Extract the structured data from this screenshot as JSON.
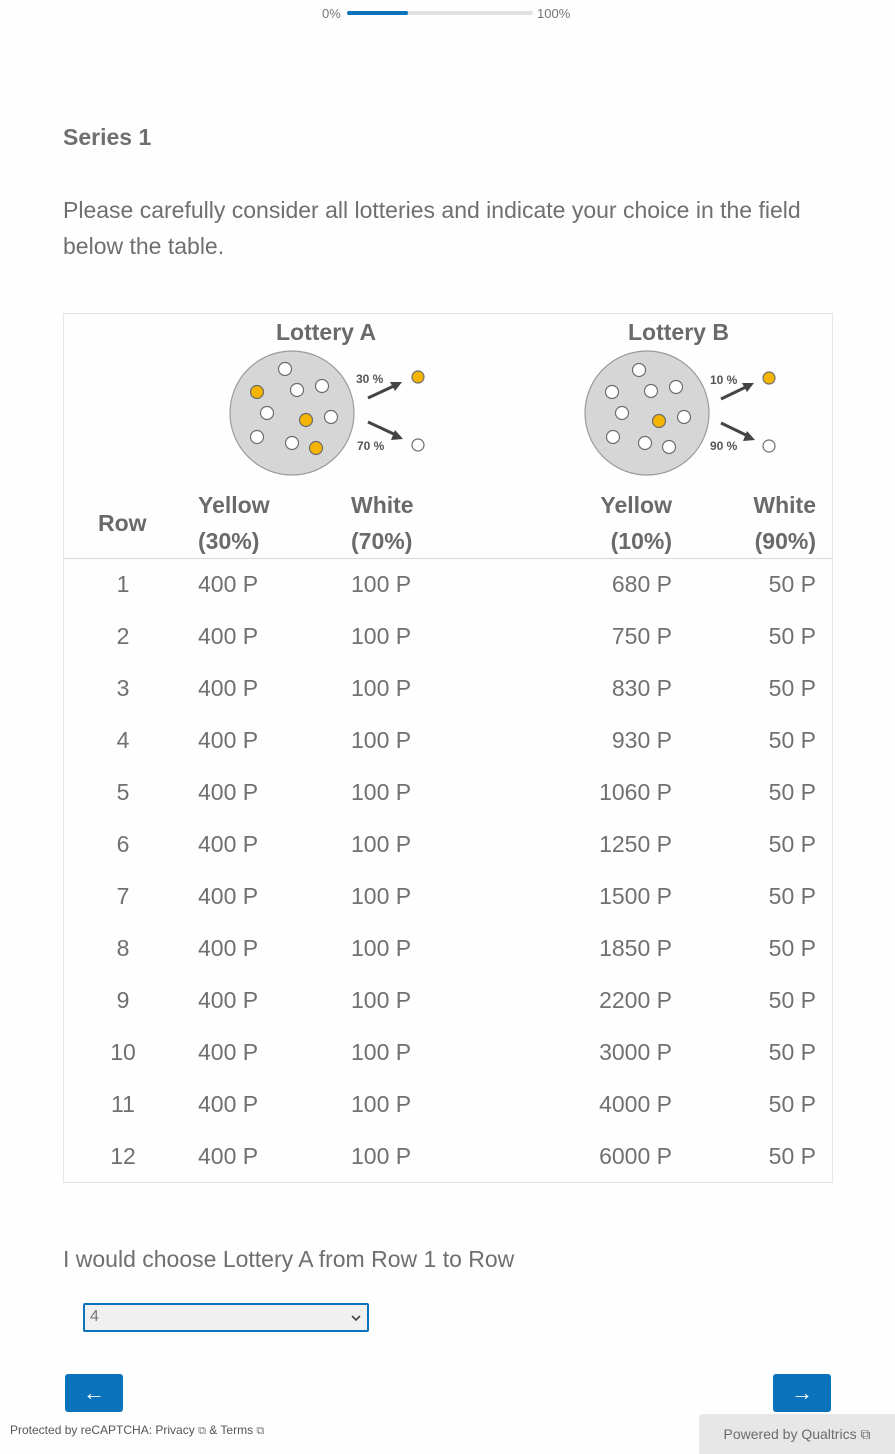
{
  "progress": {
    "start_label": "0%",
    "end_label": "100%",
    "value": 0.33,
    "fill_color": "#0b73bb"
  },
  "question": {
    "title": "Series 1",
    "instructions": "Please carefully consider all lotteries and indicate your choice in the field below the table."
  },
  "table": {
    "lottery_a": {
      "title": "Lottery A",
      "img_top_pct": "30 %",
      "img_bottom_pct": "70 %"
    },
    "lottery_b": {
      "title": "Lottery B",
      "img_top_pct": "10 %",
      "img_bottom_pct": "90 %"
    },
    "headers": {
      "row": "Row",
      "a_yellow_1": "Yellow",
      "a_yellow_2": "(30%)",
      "a_white_1": "White",
      "a_white_2": "(70%)",
      "b_yellow_1": "Yellow",
      "b_yellow_2": "(10%)",
      "b_white_1": "White",
      "b_white_2": "(90%)"
    },
    "rows": [
      {
        "row": "1",
        "a_yellow": "400 P",
        "a_white": "100 P",
        "b_yellow": "680 P",
        "b_white": "50 P"
      },
      {
        "row": "2",
        "a_yellow": "400 P",
        "a_white": "100 P",
        "b_yellow": "750 P",
        "b_white": "50 P"
      },
      {
        "row": "3",
        "a_yellow": "400 P",
        "a_white": "100 P",
        "b_yellow": "830 P",
        "b_white": "50 P"
      },
      {
        "row": "4",
        "a_yellow": "400 P",
        "a_white": "100 P",
        "b_yellow": "930 P",
        "b_white": "50 P"
      },
      {
        "row": "5",
        "a_yellow": "400 P",
        "a_white": "100 P",
        "b_yellow": "1060 P",
        "b_white": "50 P"
      },
      {
        "row": "6",
        "a_yellow": "400 P",
        "a_white": "100 P",
        "b_yellow": "1250 P",
        "b_white": "50 P"
      },
      {
        "row": "7",
        "a_yellow": "400 P",
        "a_white": "100 P",
        "b_yellow": "1500 P",
        "b_white": "50 P"
      },
      {
        "row": "8",
        "a_yellow": "400 P",
        "a_white": "100 P",
        "b_yellow": "1850 P",
        "b_white": "50 P"
      },
      {
        "row": "9",
        "a_yellow": "400 P",
        "a_white": "100 P",
        "b_yellow": "2200 P",
        "b_white": "50 P"
      },
      {
        "row": "10",
        "a_yellow": "400 P",
        "a_white": "100 P",
        "b_yellow": "3000 P",
        "b_white": "50 P"
      },
      {
        "row": "11",
        "a_yellow": "400 P",
        "a_white": "100 P",
        "b_yellow": "4000 P",
        "b_white": "50 P"
      },
      {
        "row": "12",
        "a_yellow": "400 P",
        "a_white": "100 P",
        "b_yellow": "6000 P",
        "b_white": "50 P"
      }
    ]
  },
  "choice": {
    "label": "I would choose Lottery A from Row 1 to Row",
    "selected": "4"
  },
  "nav": {
    "back_label": "←",
    "next_label": "→"
  },
  "footer": {
    "recaptcha_prefix": "Protected by reCAPTCHA: ",
    "privacy_label": "Privacy",
    "amp": " & ",
    "terms_label": "Terms",
    "powered_label": "Powered by Qualtrics"
  },
  "colors": {
    "accent": "#0b73bb",
    "ball_yellow": "#f4b400",
    "urn_fill": "#d6d6d6"
  }
}
